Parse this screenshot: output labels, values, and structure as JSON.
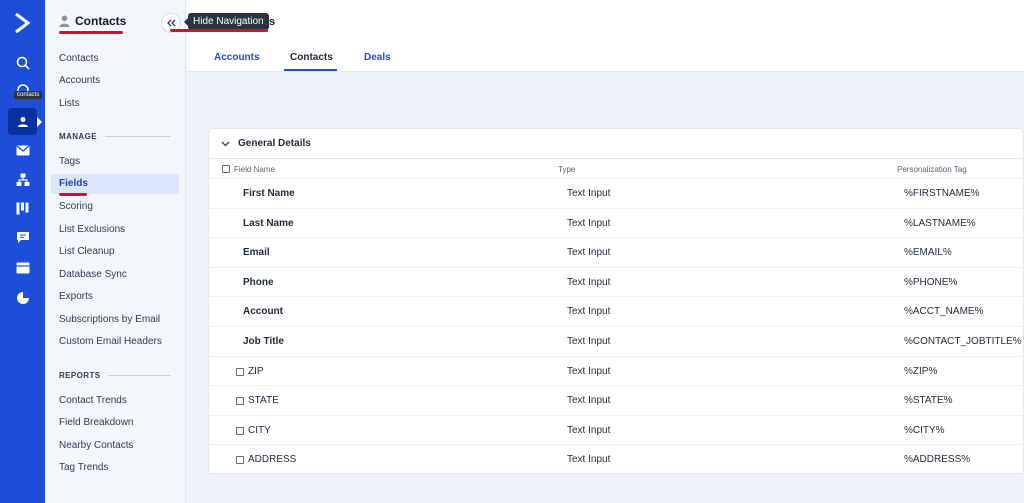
{
  "rail": {
    "items": [
      "search-icon",
      "refresh-icon",
      "contacts-icon",
      "mail-icon",
      "automation-icon",
      "deals-icon",
      "conversations-icon",
      "website-icon",
      "reports-icon"
    ],
    "active_tooltip": "contacts"
  },
  "sidebar": {
    "title": "Contacts",
    "links": [
      "Contacts",
      "Accounts",
      "Lists"
    ],
    "manage_heading": "MANAGE",
    "manage_links": [
      "Tags",
      "Fields",
      "Scoring",
      "List Exclusions",
      "List Cleanup",
      "Database Sync",
      "Exports",
      "Subscriptions by Email",
      "Custom Email Headers"
    ],
    "active_link": "Fields",
    "reports_heading": "REPORTS",
    "report_links": [
      "Contact Trends",
      "Field Breakdown",
      "Nearby Contacts",
      "Tag Trends"
    ]
  },
  "tooltip": {
    "hide_navigation": "Hide Navigation"
  },
  "header": {
    "title_fragment": "s"
  },
  "tabs": [
    {
      "label": "Accounts"
    },
    {
      "label": "Contacts"
    },
    {
      "label": "Deals"
    }
  ],
  "active_tab": "Contacts",
  "card": {
    "title": "General Details",
    "columns": {
      "field_name": "Field Name",
      "type": "Type",
      "tag": "Personalization Tag"
    },
    "rows": [
      {
        "name": "First Name",
        "type": "Text Input",
        "tag": "%FIRSTNAME%",
        "checkbox": false,
        "bold": true
      },
      {
        "name": "Last Name",
        "type": "Text Input",
        "tag": "%LASTNAME%",
        "checkbox": false,
        "bold": true
      },
      {
        "name": "Email",
        "type": "Text Input",
        "tag": "%EMAIL%",
        "checkbox": false,
        "bold": true
      },
      {
        "name": "Phone",
        "type": "Text Input",
        "tag": "%PHONE%",
        "checkbox": false,
        "bold": true
      },
      {
        "name": "Account",
        "type": "Text Input",
        "tag": "%ACCT_NAME%",
        "checkbox": false,
        "bold": true
      },
      {
        "name": "Job Title",
        "type": "Text Input",
        "tag": "%CONTACT_JOBTITLE%",
        "checkbox": false,
        "bold": true
      },
      {
        "name": "ZIP",
        "type": "Text Input",
        "tag": "%ZIP%",
        "checkbox": true,
        "bold": false
      },
      {
        "name": "STATE",
        "type": "Text Input",
        "tag": "%STATE%",
        "checkbox": true,
        "bold": false
      },
      {
        "name": "CITY",
        "type": "Text Input",
        "tag": "%CITY%",
        "checkbox": true,
        "bold": false
      },
      {
        "name": "ADDRESS",
        "type": "Text Input",
        "tag": "%ADDRESS%",
        "checkbox": true,
        "bold": false
      }
    ]
  },
  "colors": {
    "brand": "#1e4ed8",
    "brand_dark": "#0a2f9e",
    "highlight": "#d90f2a"
  }
}
